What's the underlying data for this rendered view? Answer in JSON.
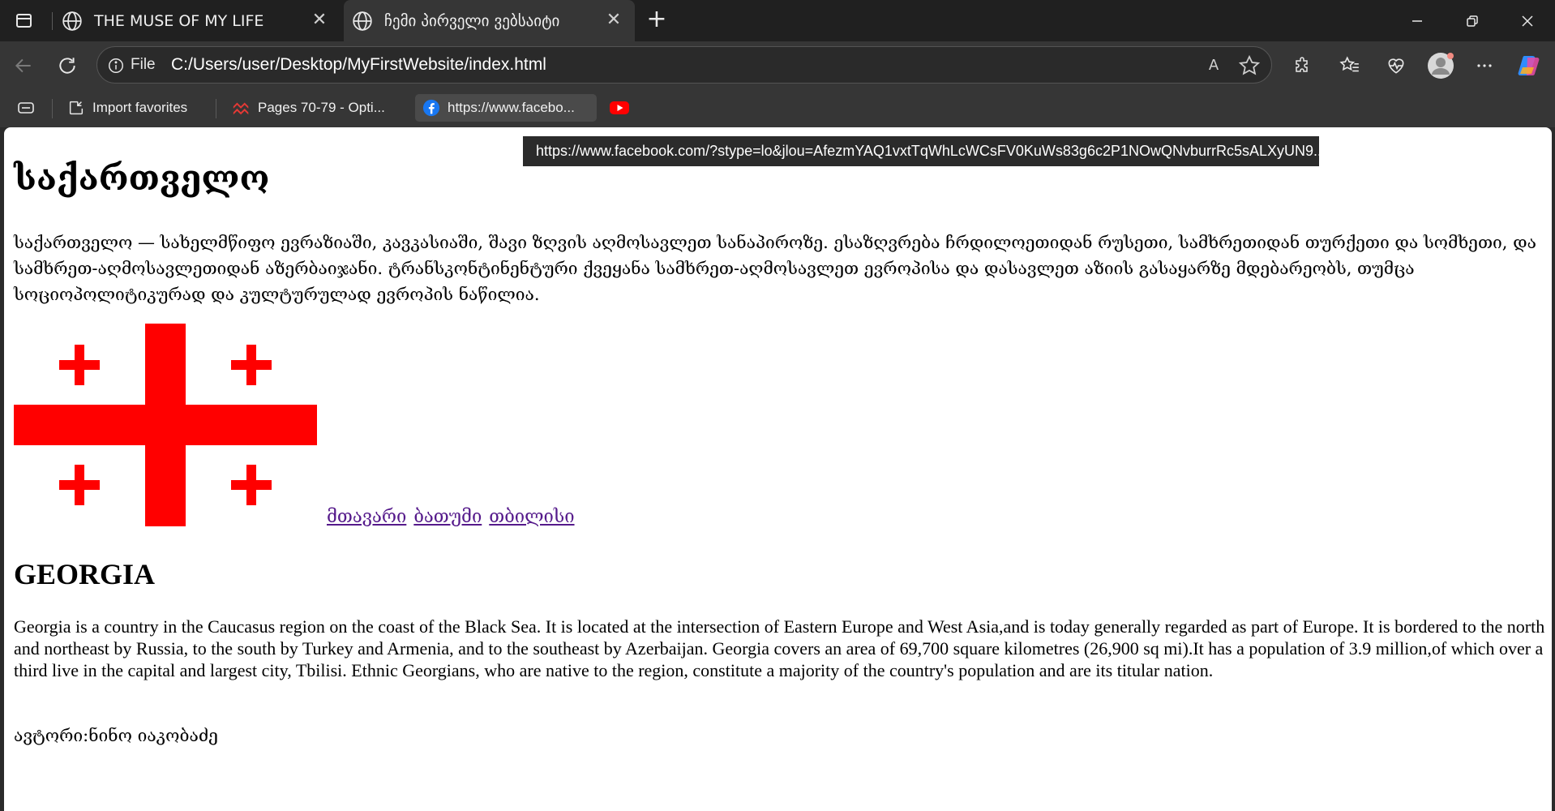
{
  "browser": {
    "tabs": [
      {
        "title": "THE MUSE OF MY LIFE",
        "active": false
      },
      {
        "title": "ჩემი პირველი ვებსაიტი",
        "active": true
      }
    ],
    "address": {
      "scheme_label": "File",
      "url": "C:/Users/user/Desktop/MyFirstWebsite/index.html"
    },
    "bookmarks": [
      {
        "label": "Import favorites",
        "icon": "import-icon"
      },
      {
        "label": "Pages 70-79 - Opti...",
        "icon": "pages-icon"
      },
      {
        "label": "https://www.facebo...",
        "icon": "facebook-icon"
      },
      {
        "label": "",
        "icon": "youtube-icon"
      }
    ],
    "tooltip": "https://www.facebook.com/?stype=lo&jlou=AfezmYAQ1vxtTqWhLcWCsFV0KuWs83g6c2P1NOwQNvburrRc5sALXyUN9...",
    "colors": {
      "chrome_dark": "#202020",
      "toolbar": "#363636",
      "link_visited": "#551a8b",
      "flag_red": "#ff0000"
    }
  },
  "page": {
    "heading_ka": "საქართველო",
    "paragraph_ka": "საქართველო — სახელმწიფო ევრაზიაში, კავკასიაში, შავი ზღვის აღმოსავლეთ სანაპიროზე. ესაზღვრება ჩრდილოეთიდან რუსეთი, სამხრეთიდან თურქეთი და სომხეთი, და სამხრეთ-აღმოსავლეთიდან აზერბაიჯანი. ტრანსკონტინენტური ქვეყანა სამხრეთ-აღმოსავლეთ ევროპისა და დასავლეთ აზიის გასაყარზე მდებარეობს, თუმცა სოციოპოლიტიკურად და კულტურულად ევროპის ნაწილია.",
    "links": [
      "მთავარი",
      "ბათუმი",
      "თბილისი"
    ],
    "heading_en": "GEORGIA",
    "paragraph_en": "Georgia is a country in the Caucasus region on the coast of the Black Sea. It is located at the intersection of Eastern Europe and West Asia,and is today generally regarded as part of Europe. It is bordered to the north and northeast by Russia, to the south by Turkey and Armenia, and to the southeast by Azerbaijan. Georgia covers an area of 69,700 square kilometres (26,900 sq mi).It has a population of 3.9 million,of which over a third live in the capital and largest city, Tbilisi. Ethnic Georgians, who are native to the region, constitute a majority of the country's population and are its titular nation.",
    "author": "ავტორი:ნინო იაკობაძე"
  }
}
